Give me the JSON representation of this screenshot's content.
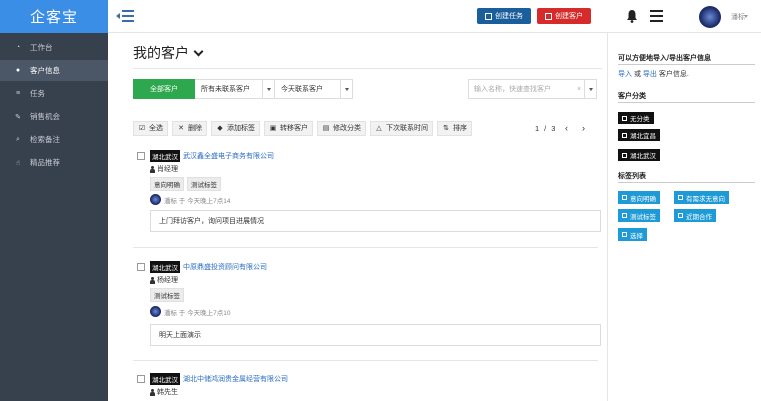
{
  "app": {
    "logo": "企客宝"
  },
  "header": {
    "create_task": "创建任务",
    "create_customer": "创建客户",
    "user_name": "潘标"
  },
  "sidebar": {
    "items": [
      {
        "label": "工作台",
        "icon": "dashboard-icon"
      },
      {
        "label": "客户信息",
        "icon": "users-icon",
        "active": true
      },
      {
        "label": "任务",
        "icon": "list-icon"
      },
      {
        "label": "销售机会",
        "icon": "wrench-icon"
      },
      {
        "label": "检索备注",
        "icon": "search-icon"
      },
      {
        "label": "精品推荐",
        "icon": "thumbs-up-icon"
      }
    ]
  },
  "main": {
    "title": "我的客户",
    "filters": {
      "all": "全部客户",
      "contact_status": "所有未联系客户",
      "contact_time": "今天联系客户",
      "search_placeholder": "输入名称，快速查找客户",
      "search_clear": "×"
    },
    "toolbar": {
      "select_all": "全选",
      "delete": "删除",
      "add_tag": "添加标签",
      "transfer": "转移客户",
      "modify_category": "修改分类",
      "next_contact": "下次联系时间",
      "sort": "排序"
    },
    "pager": {
      "current": "1",
      "separator": "/",
      "total": "3"
    },
    "records": [
      {
        "region": "湖北武汉",
        "company": "武汉鑫全盛电子商务有限公司",
        "contact": "肖经理",
        "tags": [
          "意向明确",
          "测试标签"
        ],
        "followup_meta": "潘标 于 今天晚上7点14",
        "followup_text": "上门拜访客户，询问项目进展情况"
      },
      {
        "region": "湖北武汉",
        "company": "中原鼎盛投资顾问有限公司",
        "contact": "杨经理",
        "tags": [
          "测试标签"
        ],
        "followup_meta": "潘标 于 今天晚上7点10",
        "followup_text": "明天上面演示"
      },
      {
        "region": "湖北武汉",
        "company": "湖北中储鸿润贵金属经营有限公司",
        "contact": "韩先生",
        "tags": [],
        "followup_meta": "",
        "followup_text": ""
      }
    ]
  },
  "right_panel": {
    "import_title": "可以方便地导入/导出客户信息",
    "import_link": "导入",
    "or": "或",
    "export_link": "导出",
    "import_suffix": "客户信息.",
    "category_title": "客户分类",
    "categories": [
      "无分类",
      "湖北宜昌",
      "湖北武汉"
    ],
    "tags_title": "标签列表",
    "tag_list": [
      "意向明确",
      "有需求无意向",
      "测试标签",
      "近期合作",
      "选择"
    ]
  },
  "colors": {
    "logo_bg": "#3a8ee6",
    "sidebar_bg": "#37404d",
    "create_task_bg": "#1a5f9c",
    "create_customer_bg": "#d52b2b",
    "all_customers_bg": "#2da84f",
    "tag_button_bg": "#1e9ad6",
    "link": "#2a6ec2"
  }
}
